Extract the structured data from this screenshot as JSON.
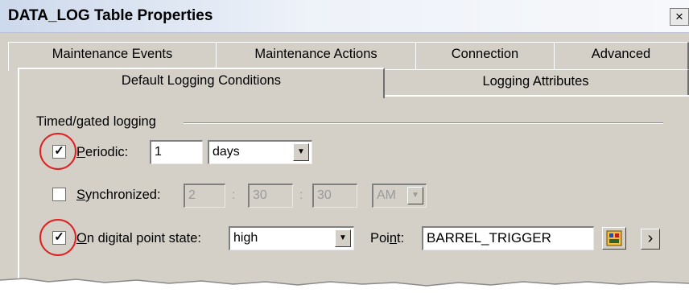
{
  "window": {
    "title": "DATA_LOG Table Properties",
    "close_glyph": "×"
  },
  "tabs_back": [
    "Maintenance Events",
    "Maintenance Actions",
    "Connection",
    "Advanced"
  ],
  "tabs_front": [
    "Default Logging Conditions",
    "Logging Attributes"
  ],
  "active_tab": "Default Logging Conditions",
  "group": {
    "label": "Timed/gated logging"
  },
  "periodic": {
    "checked": true,
    "label_prefix": "P",
    "label_rest": "eriodic:",
    "value": "1",
    "unit": "days"
  },
  "synchronized": {
    "checked": false,
    "label_prefix": "S",
    "label_rest": "ynchronized:",
    "hour": "2",
    "minute": "30",
    "second": "30",
    "ampm": "AM",
    "separator": ":"
  },
  "digital": {
    "checked": true,
    "label_prefix": "O",
    "label_rest": "n digital point state:",
    "state": "high",
    "point_label_pre": "Poi",
    "point_label_mnemonic": "n",
    "point_label_post": "t:",
    "point_value": "BARREL_TRIGGER"
  },
  "colors": {
    "highlight_ring": "#e02020",
    "panel": "#d4d0c8"
  },
  "icons": {
    "check": "✓",
    "dropdown": "▼",
    "browse": "tag-browse-icon",
    "next": "›"
  }
}
